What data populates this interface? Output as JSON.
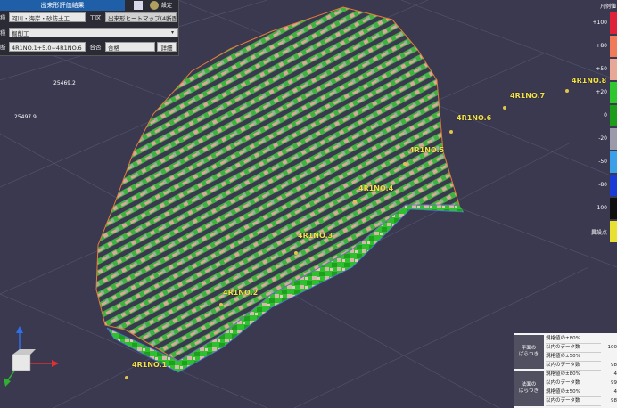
{
  "panel": {
    "title": "出来形評価結果",
    "settings_label": "設定",
    "row1_label": "種",
    "work_type": "河川・海岸・砂防土工",
    "kouku_label": "工区",
    "view_mode": "出来形ヒートマップ(4断面)",
    "row2_label": "種",
    "detail_type": "掘削工",
    "row3_label": "断",
    "range": "4R1NO.1+5.0~4R1NO.6",
    "judge_label": "合否",
    "judge_value": "合格",
    "detail_button": "詳細"
  },
  "legend": {
    "title": "凡例値",
    "labels": [
      "+100",
      "+80",
      "+50",
      "+20",
      "0",
      "-20",
      "-50",
      "-80",
      "-100",
      "異設点"
    ],
    "colors": [
      "#e0213a",
      "#f07a5a",
      "#e8a898",
      "#2ec82e",
      "#1a9e1a",
      "#9a9aaa",
      "#3aa0e8",
      "#1a3ad8",
      "#101010",
      "#e8e030"
    ]
  },
  "coords": [
    "25469.2",
    "25497.9"
  ],
  "sections": [
    "4R1NO.1",
    "4R1NO.2",
    "4R1NO.3",
    "4R1NO.4",
    "4R1NO.5",
    "4R1NO.6",
    "4R1NO.7",
    "4R1NO.8"
  ],
  "stats": {
    "group1": "平面の\nばらつき",
    "group2": "法面の\nばらつき",
    "rows": [
      {
        "label": "規格値の±80%",
        "value": ""
      },
      {
        "label": "以内のデータ数",
        "value": "100"
      },
      {
        "label": "規格値の±50%",
        "value": ""
      },
      {
        "label": "以内のデータ数",
        "value": "98"
      },
      {
        "label": "規格値の±80%",
        "value": "4"
      },
      {
        "label": "以内のデータ数",
        "value": "99"
      },
      {
        "label": "規格値の±50%",
        "value": "4"
      },
      {
        "label": "以内のデータ数",
        "value": "98"
      }
    ]
  }
}
